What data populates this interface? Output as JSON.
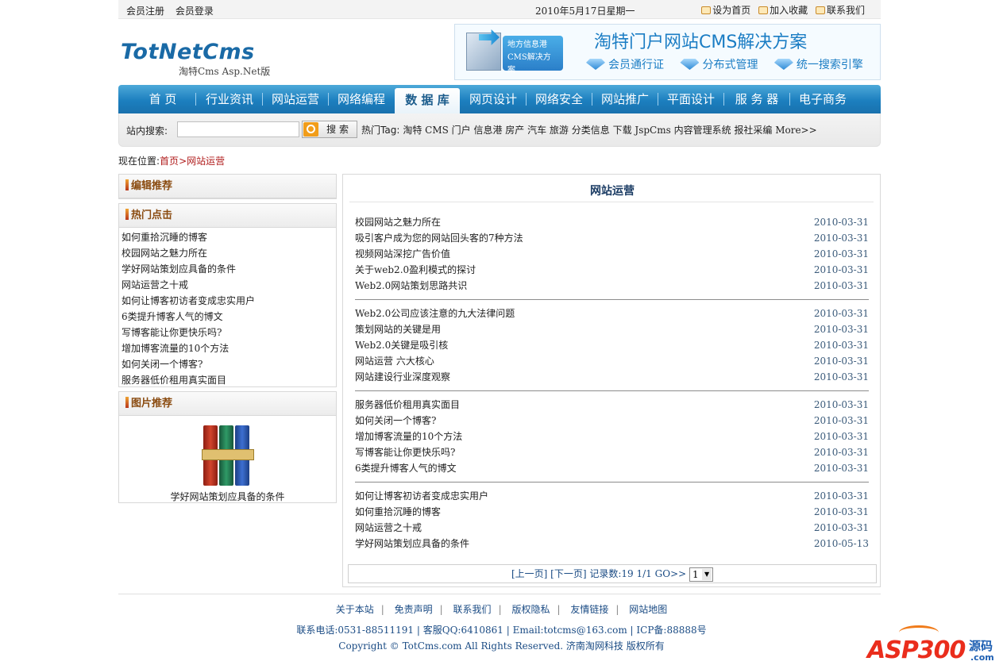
{
  "topbar": {
    "register": "会员注册",
    "login": "会员登录",
    "date": "2010年5月17日星期一",
    "set_home": "设为首页",
    "favorite": "加入收藏",
    "contact": "联系我们"
  },
  "logo": {
    "name": "TotNetCms",
    "sub": "淘特Cms Asp.Net版"
  },
  "banner": {
    "tag_line1": "地方信息港",
    "tag_line2": "CMS解决方案",
    "title": "淘特门户网站CMS解决方案",
    "features": [
      "会员通行证",
      "分布式管理",
      "统一搜索引擎"
    ]
  },
  "nav": {
    "items": [
      "首 页",
      "行业资讯",
      "网站运营",
      "网络编程",
      "数 据 库",
      "网页设计",
      "网络安全",
      "网站推广",
      "平面设计",
      "服 务 器",
      "电子商务"
    ],
    "active_index": 4
  },
  "search": {
    "label": "站内搜索:",
    "value": "",
    "button": "搜 索",
    "hot_label": "热门Tag:",
    "hot_tags": "淘特 CMS 门户 信息港 房产 汽车 旅游 分类信息 下载 JspCms 内容管理系统 报社采编 More>>"
  },
  "breadcrumb": {
    "label": "现在位置:",
    "home": "首页",
    "sep": ">",
    "current": "网站运营"
  },
  "sidebar": {
    "editor_title": "编辑推荐",
    "hot_title": "热门点击",
    "hot_items": [
      "如何重拾沉睡的博客",
      "校园网站之魅力所在",
      "学好网站策划应具备的条件",
      "网站运营之十戒",
      "如何让博客初访者变成忠实用户",
      "6类提升博客人气的博文",
      "写博客能让你更快乐吗?",
      "增加博客流量的10个方法",
      "如何关闭一个博客?",
      "服务器低价租用真实面目"
    ],
    "pic_title": "图片推荐",
    "pic_caption": "学好网站策划应具备的条件"
  },
  "main": {
    "title": "网站运营",
    "groups": [
      [
        {
          "t": "校园网站之魅力所在",
          "d": "2010-03-31"
        },
        {
          "t": "吸引客户成为您的网站回头客的7种方法",
          "d": "2010-03-31"
        },
        {
          "t": "视频网站深挖广告价值",
          "d": "2010-03-31"
        },
        {
          "t": "关于web2.0盈利模式的探讨",
          "d": "2010-03-31"
        },
        {
          "t": "Web2.0网站策划思路共识",
          "d": "2010-03-31"
        }
      ],
      [
        {
          "t": "Web2.0公司应该注意的九大法律问题",
          "d": "2010-03-31"
        },
        {
          "t": "策划网站的关键是用",
          "d": "2010-03-31"
        },
        {
          "t": "Web2.0关键是吸引核",
          "d": "2010-03-31"
        },
        {
          "t": "网站运营 六大核心",
          "d": "2010-03-31"
        },
        {
          "t": "网站建设行业深度观察",
          "d": "2010-03-31"
        }
      ],
      [
        {
          "t": "服务器低价租用真实面目",
          "d": "2010-03-31"
        },
        {
          "t": "如何关闭一个博客?",
          "d": "2010-03-31"
        },
        {
          "t": "增加博客流量的10个方法",
          "d": "2010-03-31"
        },
        {
          "t": "写博客能让你更快乐吗?",
          "d": "2010-03-31"
        },
        {
          "t": "6类提升博客人气的博文",
          "d": "2010-03-31"
        }
      ],
      [
        {
          "t": "如何让博客初访者变成忠实用户",
          "d": "2010-03-31"
        },
        {
          "t": "如何重拾沉睡的博客",
          "d": "2010-03-31"
        },
        {
          "t": "网站运营之十戒",
          "d": "2010-03-31"
        },
        {
          "t": "学好网站策划应具备的条件",
          "d": "2010-05-13"
        }
      ]
    ],
    "pager": {
      "prev": "[上一页]",
      "next": "[下一页]",
      "records": "记录数:19 1/1",
      "go": "GO>>",
      "page": "1"
    }
  },
  "footer": {
    "links": [
      "关于本站",
      "免责声明",
      "联系我们",
      "版权隐私",
      "友情链接",
      "网站地图"
    ],
    "info": "联系电话:0531-88511191 | 客服QQ:6410861 | Email:totcms@163.com | ICP备:88888号",
    "copyright": "Copyright © TotCms.com All Rights Reserved. 济南淘网科技 版权所有"
  },
  "watermark": {
    "text": "ASP300",
    "cn": "源码",
    "domain": ".com"
  }
}
